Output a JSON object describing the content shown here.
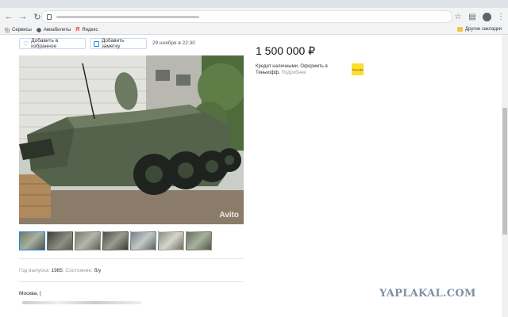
{
  "bookmarks": {
    "items": [
      {
        "label": "Сервисы"
      },
      {
        "label": "Авиабилеты"
      },
      {
        "label": "Яндекс"
      }
    ],
    "other_folder": "Другие закладки"
  },
  "listing": {
    "favorite_label": "Добавить в избранное",
    "note_label": "Добавить заметку",
    "date": "29 ноября в 22:30",
    "price": "1 500 000 ₽",
    "credit_text": "Кредит наличными. Оформить в Тинькофф.",
    "credit_link": "Подробнее",
    "tinkoff_logo": "Тинькофф",
    "watermark": "Avito",
    "params": {
      "year_label": "Год выпуска:",
      "year_value": "1985",
      "state_label": "Состояние:",
      "state_value": "б/у"
    },
    "city": "Москва, ("
  },
  "site_watermark": "YAPLAKAL.COM",
  "thumbs_count": 7,
  "colors": {
    "accent": "#1e88e5",
    "tinkoff": "#ffdd2d"
  }
}
